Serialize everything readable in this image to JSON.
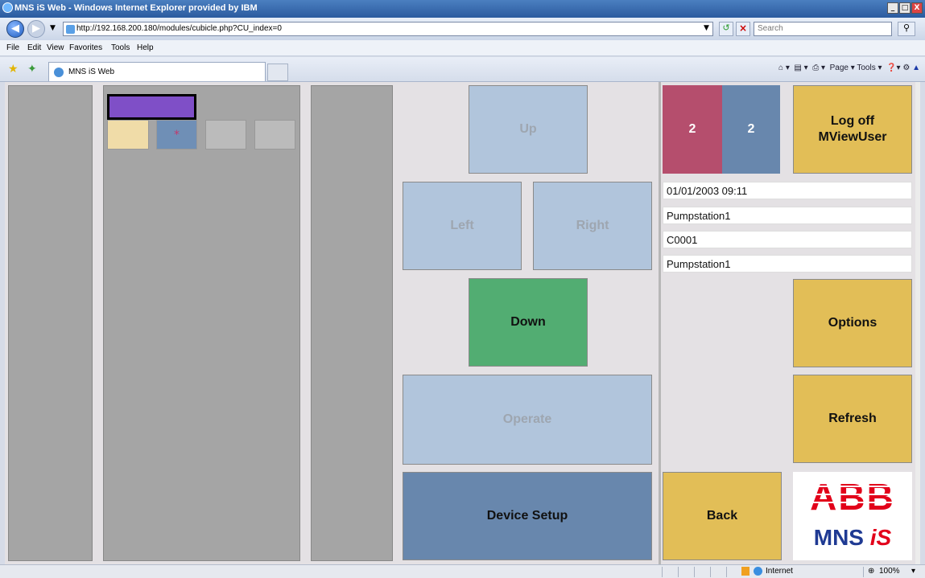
{
  "window": {
    "title": "MNS iS Web - Windows Internet Explorer provided by IBM",
    "minimize": "_",
    "restore": "□",
    "close": "X"
  },
  "browser": {
    "url": "http://192.168.200.180/modules/cubicle.php?CU_index=0",
    "search_placeholder": "Search",
    "menu": [
      "File",
      "Edit",
      "View",
      "Favorites",
      "Tools",
      "Help"
    ],
    "tab_title": "MNS iS Web",
    "command_bar": "Page ▾   Tools ▾",
    "status_zone": "Internet",
    "zoom": "100%"
  },
  "panel_left": {
    "selected_device_color": "#7f4fc7",
    "small_marker": "*",
    "tile_colors": [
      "#f0dca8",
      "#6f8fb6",
      "#bbbbbb",
      "#bbbbbb"
    ]
  },
  "controls": {
    "up": "Up",
    "left": "Left",
    "right": "Right",
    "down": "Down",
    "operate": "Operate",
    "device_setup": "Device Setup"
  },
  "side": {
    "counter_red": "2",
    "counter_blue": "2",
    "logoff_line1": "Log off",
    "logoff_line2": "MViewUser",
    "datetime": "01/01/2003 09:11",
    "station": "Pumpstation1",
    "cubicle": "C0001",
    "station2": "Pumpstation1",
    "options": "Options",
    "refresh": "Refresh",
    "back": "Back",
    "logo_top": "ABB",
    "logo_bottom_1": "MNS",
    "logo_bottom_2": "iS"
  },
  "colors": {
    "accent_gold": "#e2be57",
    "down_green": "#52ad72",
    "device_setup_blue": "#6887ad",
    "counter_red": "#b54e6d",
    "counter_blue": "#6887ad",
    "abb_red": "#e2001a",
    "mns_blue": "#1f3a93"
  }
}
